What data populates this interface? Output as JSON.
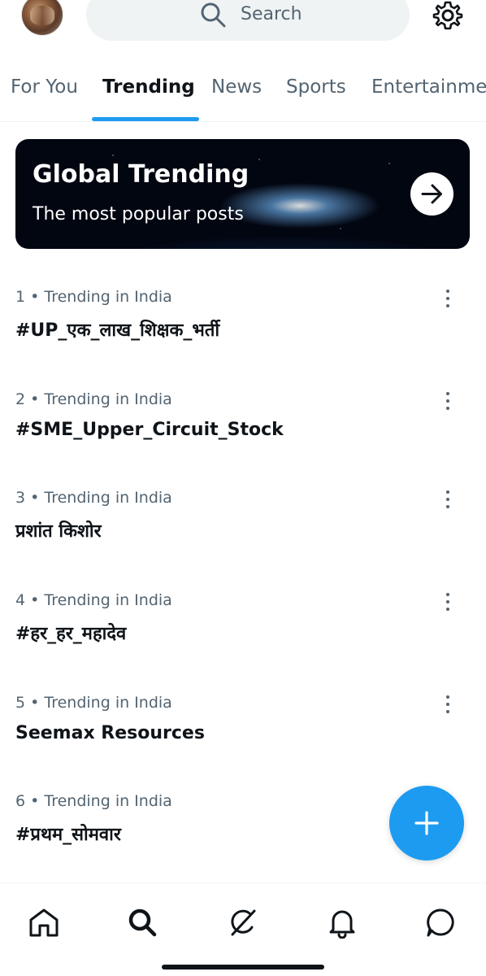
{
  "header": {
    "search_placeholder": "Search",
    "icons": [
      "avatar",
      "search-icon",
      "gear-icon"
    ]
  },
  "tabs": [
    {
      "label": "For You",
      "active": false
    },
    {
      "label": "Trending",
      "active": true
    },
    {
      "label": "News",
      "active": false
    },
    {
      "label": "Sports",
      "active": false
    },
    {
      "label": "Entertainme",
      "active": false
    }
  ],
  "banner": {
    "title": "Global Trending",
    "subtitle": "The most popular posts",
    "icon": "arrow-right-icon"
  },
  "trends": [
    {
      "rank": "1",
      "location": "Trending in India",
      "name": "#UP_एक_लाख_शिक्षक_भर्ती"
    },
    {
      "rank": "2",
      "location": "Trending in India",
      "name": "#SME_Upper_Circuit_Stock"
    },
    {
      "rank": "3",
      "location": "Trending in India",
      "name": "प्रशांत किशोर"
    },
    {
      "rank": "4",
      "location": "Trending in India",
      "name": "#हर_हर_महादेव"
    },
    {
      "rank": "5",
      "location": "Trending in India",
      "name": "Seemax Resources"
    },
    {
      "rank": "6",
      "location": "Trending in India",
      "name": "#प्रथम_सोमवार"
    }
  ],
  "bullet": "•",
  "fab": {
    "icon": "plus-icon"
  },
  "bottom_nav": {
    "items": [
      "home-icon",
      "search-icon",
      "grok-icon",
      "bell-icon",
      "messages-icon"
    ],
    "active": "search-icon"
  },
  "colors": {
    "accent": "#1d9bf0",
    "text": "#0f1419",
    "secondary": "#536471"
  }
}
